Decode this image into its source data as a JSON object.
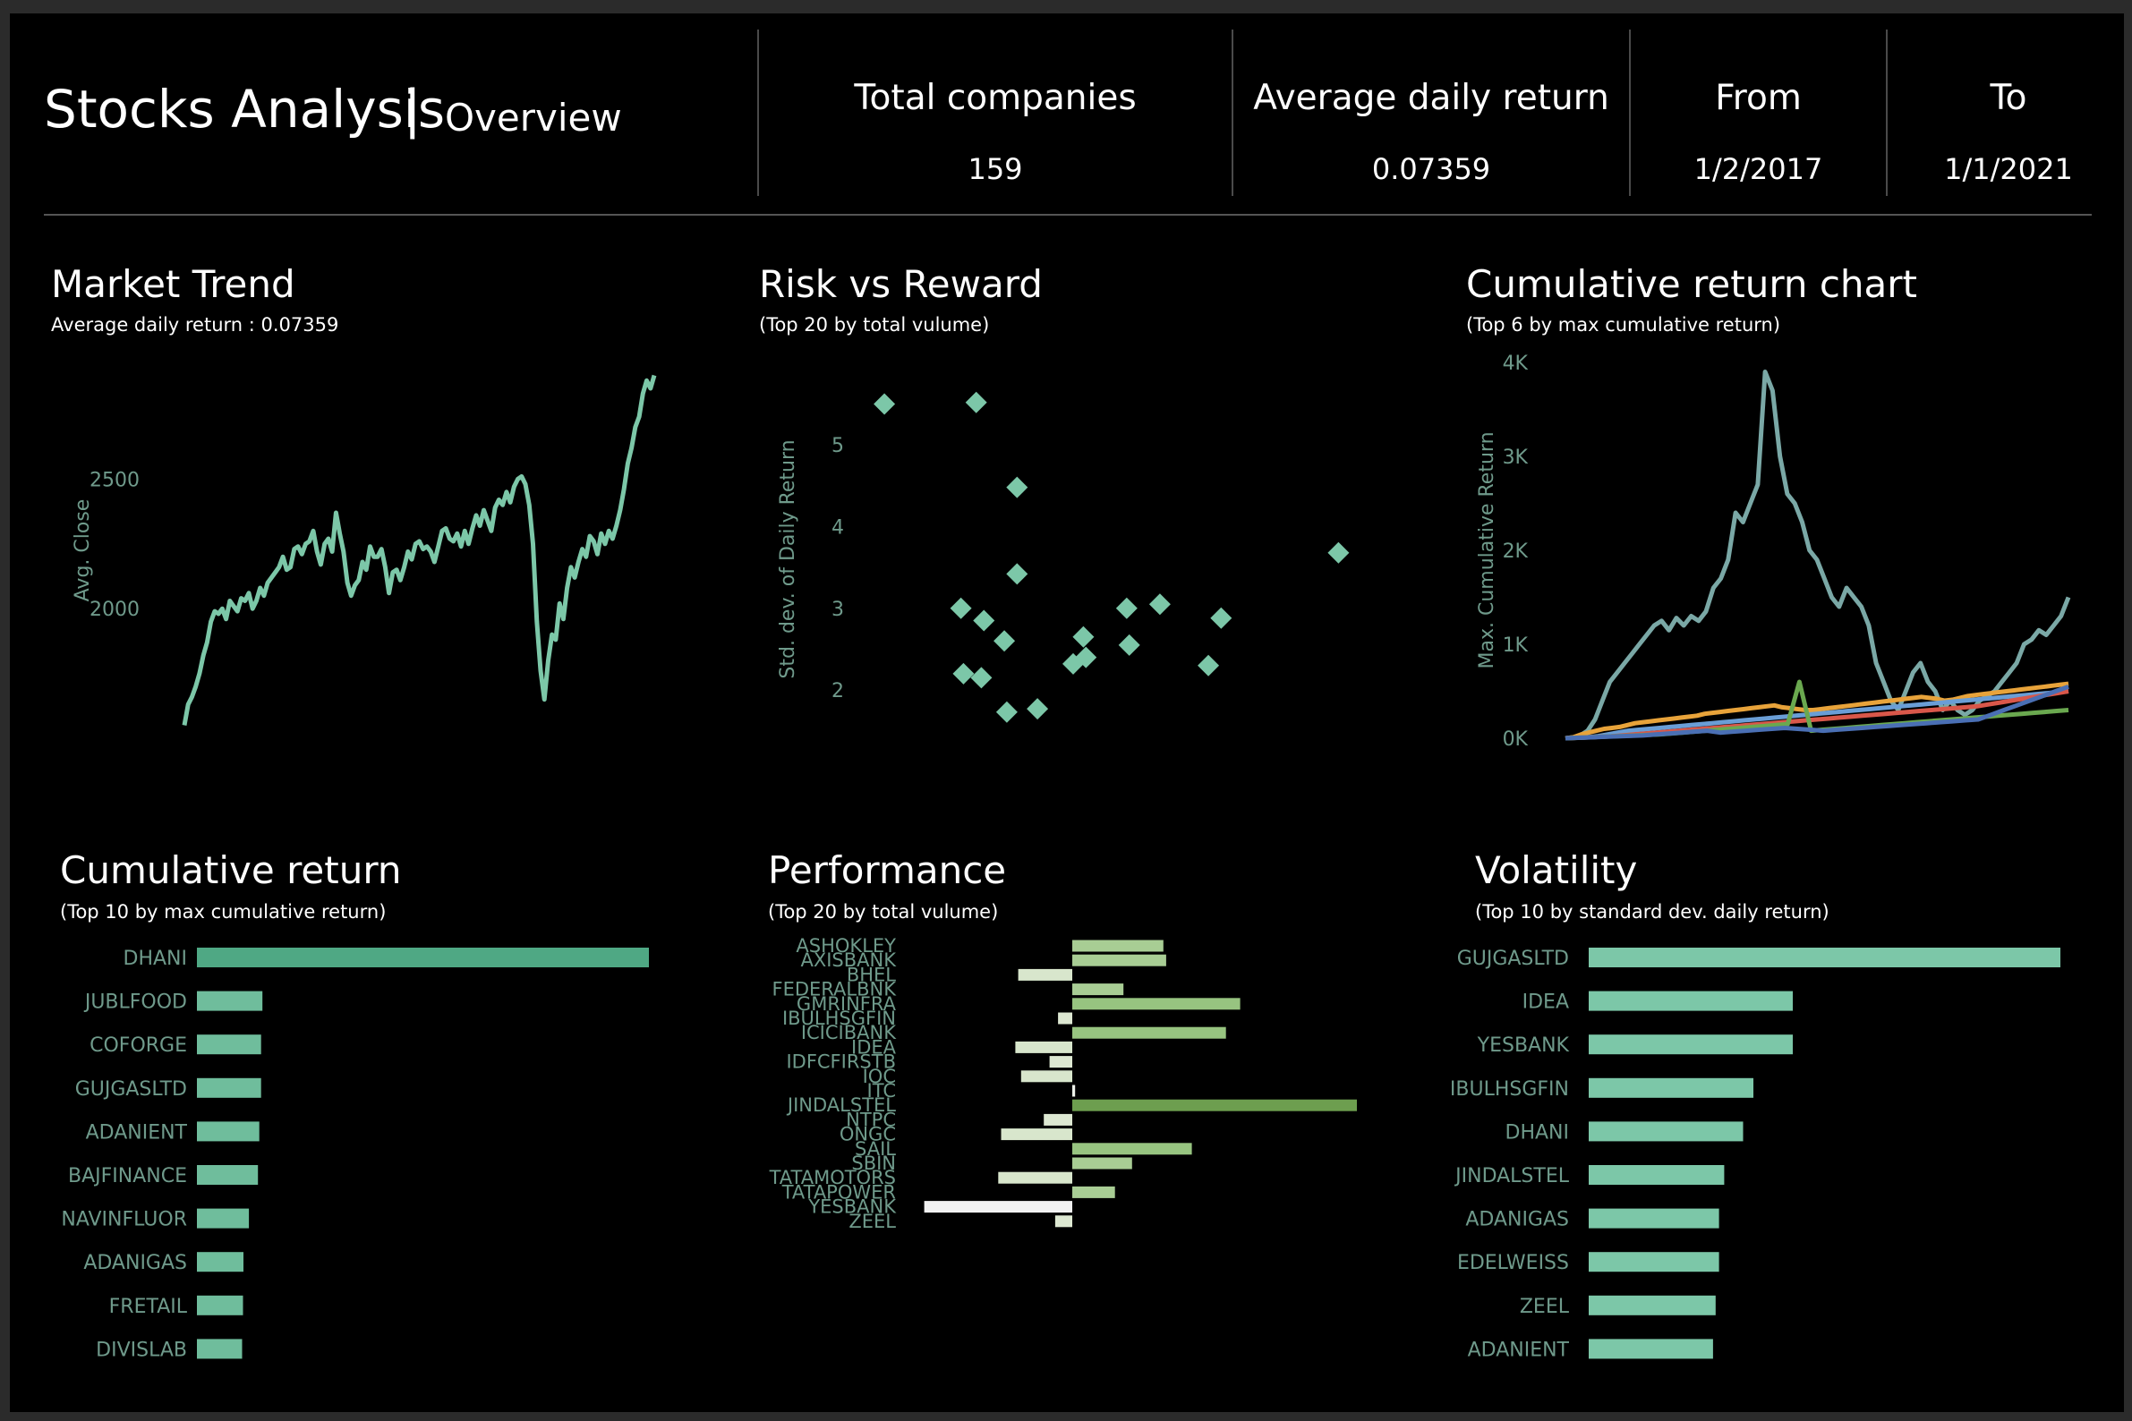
{
  "header": {
    "title": "Stocks Analysis",
    "separator": "|",
    "subtitle": "Overview",
    "kpis": [
      {
        "label": "Total companies",
        "value": "159"
      },
      {
        "label": "Average daily return",
        "value": "0.07359"
      },
      {
        "label": "From",
        "value": "1/2/2017"
      },
      {
        "label": "To",
        "value": "1/1/2021"
      }
    ]
  },
  "panels": {
    "market_trend": {
      "title": "Market Trend",
      "subtitle": "Average daily return : 0.07359"
    },
    "risk_reward": {
      "title": "Risk vs Reward",
      "subtitle": "(Top 20 by total vulume)"
    },
    "cumulative_chart": {
      "title": "Cumulative return chart",
      "subtitle": "(Top 6 by max cumulative return)"
    },
    "cumulative_return": {
      "title": "Cumulative return",
      "subtitle": "(Top 10 by max cumulative return)"
    },
    "performance": {
      "title": "Performance",
      "subtitle": "(Top 20 by total vulume)"
    },
    "volatility": {
      "title": "Volatility",
      "subtitle": "(Top 10 by standard dev. daily return)"
    }
  },
  "colors": {
    "background": "#000000",
    "teal": "#7cc7a8",
    "bar_teal": "#6fbd9c",
    "dhani_bar": "#4fa884",
    "axis_text": "#6f9a8b",
    "white": "#ffffff"
  },
  "chart_data": [
    {
      "id": "market_trend",
      "type": "line",
      "ylabel": "Avg. Close",
      "xlabel": "",
      "yticks": [
        2000,
        2500
      ],
      "ylim": [
        1500,
        2950
      ],
      "x_range": [
        0,
        128
      ],
      "values": [
        1550,
        1630,
        1660,
        1700,
        1750,
        1820,
        1870,
        1950,
        1990,
        1980,
        2000,
        1960,
        2030,
        2010,
        1990,
        2040,
        2030,
        2060,
        2000,
        2030,
        2080,
        2050,
        2100,
        2120,
        2140,
        2160,
        2200,
        2150,
        2160,
        2230,
        2240,
        2210,
        2250,
        2260,
        2300,
        2220,
        2170,
        2250,
        2270,
        2220,
        2370,
        2290,
        2220,
        2100,
        2050,
        2090,
        2110,
        2180,
        2150,
        2240,
        2200,
        2200,
        2230,
        2160,
        2060,
        2140,
        2150,
        2110,
        2160,
        2220,
        2190,
        2250,
        2260,
        2230,
        2240,
        2220,
        2180,
        2240,
        2300,
        2310,
        2270,
        2260,
        2290,
        2240,
        2300,
        2250,
        2310,
        2360,
        2320,
        2380,
        2340,
        2300,
        2390,
        2420,
        2400,
        2450,
        2410,
        2470,
        2500,
        2510,
        2480,
        2400,
        2250,
        1950,
        1760,
        1650,
        1800,
        1900,
        1880,
        2020,
        1960,
        2080,
        2160,
        2120,
        2180,
        2230,
        2200,
        2280,
        2260,
        2210,
        2290,
        2250,
        2300,
        2270,
        2320,
        2380,
        2460,
        2560,
        2620,
        2700,
        2740,
        2830,
        2880,
        2850,
        2900
      ],
      "line_color": "#7cc7a8"
    },
    {
      "id": "risk_reward",
      "type": "scatter",
      "ylabel": "Std. dev. of Daily Return",
      "xlabel": "",
      "yticks": [
        2,
        3,
        4,
        5
      ],
      "ylim": [
        1.3,
        5.9
      ],
      "xlim": [
        0,
        1
      ],
      "points": [
        {
          "x": 0.03,
          "y": 5.5
        },
        {
          "x": 0.21,
          "y": 5.52
        },
        {
          "x": 0.29,
          "y": 4.48
        },
        {
          "x": 0.29,
          "y": 3.42
        },
        {
          "x": 0.18,
          "y": 3.0
        },
        {
          "x": 0.225,
          "y": 2.85
        },
        {
          "x": 0.265,
          "y": 2.6
        },
        {
          "x": 0.185,
          "y": 2.2
        },
        {
          "x": 0.22,
          "y": 2.15
        },
        {
          "x": 0.27,
          "y": 1.73
        },
        {
          "x": 0.33,
          "y": 1.77
        },
        {
          "x": 0.4,
          "y": 2.32
        },
        {
          "x": 0.425,
          "y": 2.4
        },
        {
          "x": 0.42,
          "y": 2.65
        },
        {
          "x": 0.505,
          "y": 3.0
        },
        {
          "x": 0.57,
          "y": 3.05
        },
        {
          "x": 0.51,
          "y": 2.55
        },
        {
          "x": 0.665,
          "y": 2.3
        },
        {
          "x": 0.69,
          "y": 2.88
        },
        {
          "x": 0.92,
          "y": 3.68
        }
      ],
      "marker": "diamond",
      "color": "#7cc7a8"
    },
    {
      "id": "cumulative_chart",
      "type": "line",
      "ylabel": "Max. Cumulative Return",
      "xlabel": "",
      "yticks": [
        "0K",
        "1K",
        "2K",
        "3K",
        "4K"
      ],
      "ylim": [
        0,
        4000
      ],
      "series": [
        {
          "color": "#7aa8a6",
          "values": [
            0,
            10,
            30,
            80,
            200,
            400,
            600,
            700,
            800,
            900,
            1000,
            1100,
            1200,
            1250,
            1150,
            1280,
            1200,
            1300,
            1250,
            1350,
            1600,
            1700,
            1900,
            2400,
            2300,
            2500,
            2700,
            3900,
            3700,
            3000,
            2600,
            2500,
            2300,
            2000,
            1900,
            1700,
            1500,
            1400,
            1600,
            1500,
            1400,
            1200,
            800,
            600,
            400,
            300,
            500,
            700,
            800,
            600,
            500,
            300,
            400,
            300,
            250,
            300,
            400,
            450,
            500,
            600,
            700,
            800,
            1000,
            1050,
            1150,
            1100,
            1200,
            1300,
            1500
          ]
        },
        {
          "color": "#e8a33a",
          "values": [
            0,
            10,
            40,
            60,
            80,
            100,
            110,
            120,
            140,
            160,
            170,
            180,
            190,
            200,
            210,
            220,
            230,
            240,
            260,
            270,
            280,
            290,
            300,
            310,
            320,
            330,
            340,
            350,
            330,
            320,
            310,
            300,
            300,
            310,
            320,
            330,
            340,
            350,
            360,
            370,
            380,
            390,
            400,
            410,
            420,
            430,
            440,
            430,
            420,
            400,
            410,
            430,
            450,
            460,
            470,
            480,
            490,
            500,
            510,
            520,
            530,
            540,
            550,
            560,
            570,
            580
          ]
        },
        {
          "color": "#6a9ed6",
          "values": [
            0,
            5,
            10,
            20,
            40,
            60,
            80,
            90,
            100,
            110,
            120,
            130,
            140,
            150,
            160,
            170,
            180,
            190,
            200,
            210,
            220,
            230,
            240,
            250,
            260,
            270,
            280,
            290,
            300,
            310,
            320,
            330,
            340,
            350,
            360,
            370,
            380,
            390,
            400,
            410,
            420,
            430,
            440,
            450,
            460,
            470,
            480,
            490,
            500
          ]
        },
        {
          "color": "#d9574a",
          "values": [
            0,
            5,
            10,
            15,
            20,
            30,
            40,
            50,
            60,
            70,
            80,
            90,
            100,
            110,
            120,
            130,
            140,
            150,
            160,
            170,
            180,
            190,
            200,
            210,
            220,
            230,
            240,
            250,
            260,
            270,
            280,
            290,
            300,
            310,
            320,
            330,
            340,
            360,
            380,
            400,
            420,
            440,
            460,
            480,
            500
          ]
        },
        {
          "color": "#6aa84f",
          "values": [
            0,
            5,
            10,
            15,
            20,
            25,
            30,
            35,
            40,
            50,
            60,
            70,
            80,
            90,
            100,
            110,
            120,
            130,
            140,
            150,
            600,
            80,
            90,
            100,
            110,
            120,
            130,
            140,
            150,
            160,
            170,
            180,
            190,
            200,
            210,
            220,
            230,
            240,
            250,
            260,
            270,
            280,
            290,
            300
          ]
        },
        {
          "color": "#4a6fb4",
          "values": [
            0,
            5,
            10,
            15,
            20,
            25,
            30,
            40,
            50,
            60,
            70,
            80,
            60,
            70,
            80,
            90,
            100,
            110,
            100,
            90,
            80,
            90,
            100,
            110,
            120,
            130,
            140,
            150,
            160,
            170,
            180,
            190,
            200,
            250,
            300,
            350,
            400,
            450,
            500,
            550
          ]
        }
      ]
    },
    {
      "id": "cumulative_return",
      "type": "bar",
      "orientation": "horizontal",
      "categories": [
        "DHANI",
        "JUBLFOOD",
        "COFORGE",
        "GUJGASLTD",
        "ADANIENT",
        "BAJFINANCE",
        "NAVINFLUOR",
        "ADANIGAS",
        "FRETAIL",
        "DIVISLAB"
      ],
      "values": [
        100,
        14.5,
        14.2,
        14.2,
        13.8,
        13.5,
        11.5,
        10.3,
        10.2,
        10.0
      ],
      "colors": [
        "#4fa884",
        "#6fbd9c",
        "#6fbd9c",
        "#6fbd9c",
        "#6fbd9c",
        "#6fbd9c",
        "#6fbd9c",
        "#6fbd9c",
        "#6fbd9c",
        "#6fbd9c"
      ]
    },
    {
      "id": "performance",
      "type": "bar",
      "orientation": "horizontal",
      "categories": [
        "ASHOKLEY",
        "AXISBANK",
        "BHEL",
        "FEDERALBNK",
        "GMRINFRA",
        "IBULHSGFIN",
        "ICICIBANK",
        "IDEA",
        "IDFCFIRSTB",
        "IOC",
        "ITC",
        "JINDALSTEL",
        "NTPC",
        "ONGC",
        "SAIL",
        "SBIN",
        "TATAMOTORS",
        "TATAPOWER",
        "YESBANK",
        "ZEEL"
      ],
      "values": [
        0.32,
        0.33,
        -0.19,
        0.18,
        0.59,
        -0.05,
        0.54,
        -0.2,
        -0.08,
        -0.18,
        0.01,
        1.0,
        -0.1,
        -0.25,
        0.42,
        0.21,
        -0.26,
        0.15,
        -0.52,
        -0.06
      ],
      "colors": [
        "#a8cd94",
        "#a8cd94",
        "#d8e6cc",
        "#a8cd94",
        "#97c480",
        "#dde8d2",
        "#97c480",
        "#d8e6cc",
        "#dde8d2",
        "#d8e6cc",
        "#eef2ea",
        "#6d9e4f",
        "#dde8d2",
        "#d8e6cc",
        "#97c480",
        "#a8cd94",
        "#d8e6cc",
        "#a8cd94",
        "#f2f2f2",
        "#dde8d2"
      ]
    },
    {
      "id": "volatility",
      "type": "bar",
      "orientation": "horizontal",
      "categories": [
        "GUJGASLTD",
        "IDEA",
        "YESBANK",
        "IBULHSGFIN",
        "DHANI",
        "JINDALSTEL",
        "ADANIGAS",
        "EDELWEISS",
        "ZEEL",
        "ADANIENT"
      ],
      "values": [
        5.5,
        2.38,
        2.38,
        1.92,
        1.8,
        1.58,
        1.52,
        1.52,
        1.48,
        1.45
      ],
      "colors": [
        "#7cc7a8",
        "#7cc7a8",
        "#7cc7a8",
        "#7cc7a8",
        "#7cc7a8",
        "#7cc7a8",
        "#7cc7a8",
        "#7cc7a8",
        "#7cc7a8",
        "#7cc7a8"
      ]
    }
  ]
}
